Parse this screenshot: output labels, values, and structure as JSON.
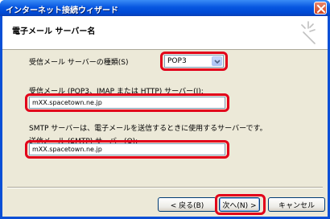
{
  "window": {
    "title": "インターネット接続ウィザード"
  },
  "header": {
    "title": "電子メール サーバー名"
  },
  "form": {
    "server_type_label": "受信メール サーバーの種類(S)",
    "server_type_value": "POP3",
    "incoming_label": "受信メール (POP3、IMAP または HTTP) サーバー(I):",
    "incoming_value": "mXX.spacetown.ne.jp",
    "smtp_note": "SMTP サーバーは、電子メールを送信するときに使用するサーバーです。",
    "outgoing_label": "送信メール (SMTP) サーバー(O):",
    "outgoing_value": "mXX.spacetown.ne.jp"
  },
  "buttons": {
    "back": "< 戻る(B)",
    "next": "次へ(N) >",
    "cancel": "キャンセル"
  },
  "colors": {
    "highlight": "#e2001a",
    "titlebar": "#0756e0",
    "dialog_bg": "#ece9d8"
  },
  "icons": {
    "close": "close-icon",
    "wizard": "sparkle-wizard-icon",
    "dropdown": "chevron-down-icon"
  }
}
